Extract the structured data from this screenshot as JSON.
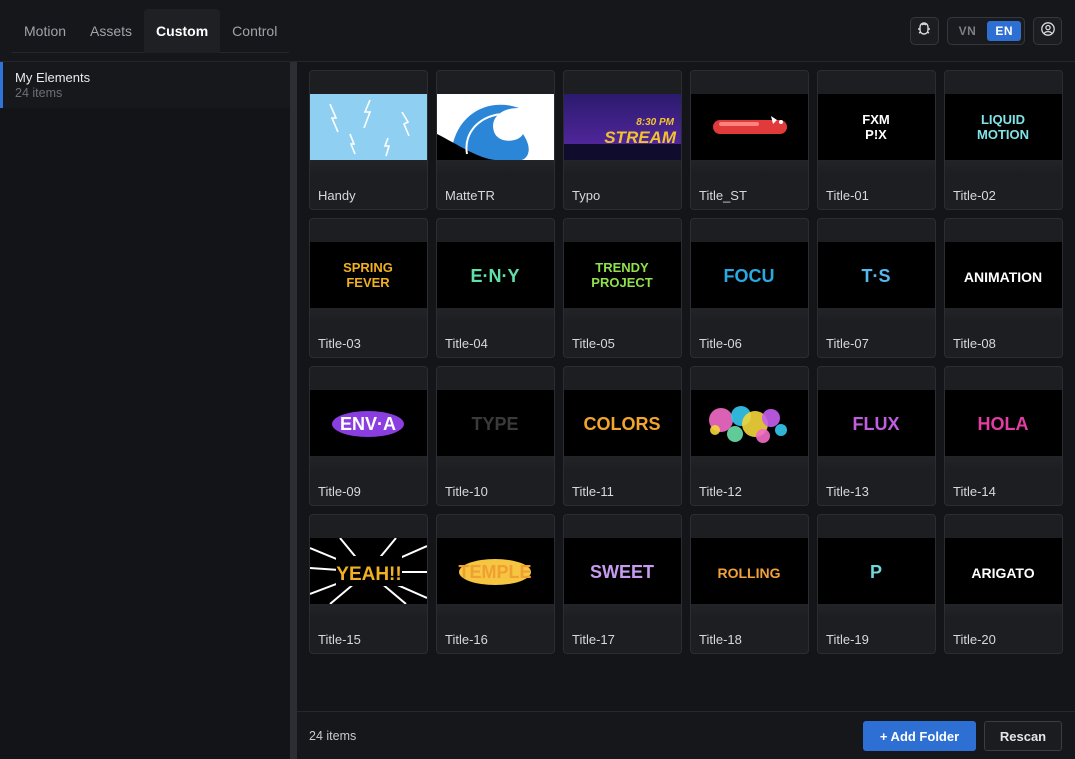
{
  "tabs": [
    {
      "label": "Motion"
    },
    {
      "label": "Assets"
    },
    {
      "label": "Custom",
      "active": true
    },
    {
      "label": "Control"
    }
  ],
  "header": {
    "icons": [
      "extension-icon",
      "user-circle-icon"
    ],
    "languages": [
      "VN",
      "EN"
    ],
    "active_language": "EN"
  },
  "sidebar": {
    "folders": [
      {
        "name": "My Elements",
        "count": "24 items",
        "selected": true
      }
    ]
  },
  "grid": {
    "items": [
      {
        "label": "Handy",
        "thumb": "lightning-sky"
      },
      {
        "label": "MatteTR",
        "thumb": "wave-matte"
      },
      {
        "label": "Typo",
        "thumb": "stream",
        "text": "STREAM",
        "sub": "8:30 PM"
      },
      {
        "label": "Title_ST",
        "thumb": "red-bar"
      },
      {
        "label": "Title-01",
        "thumb": "text",
        "text": "FXM P!X",
        "color": "#ffffff"
      },
      {
        "label": "Title-02",
        "thumb": "text",
        "text": "LIQUID MOTION",
        "color": "#7fe3e8"
      },
      {
        "label": "Title-03",
        "thumb": "text",
        "text": "SPRING FEVER",
        "color": "#f0b020"
      },
      {
        "label": "Title-04",
        "thumb": "text",
        "text": "E·N·Y",
        "color": "#5ee0a8"
      },
      {
        "label": "Title-05",
        "thumb": "text",
        "text": "TRENDY PROJECT",
        "color": "#8fe24b"
      },
      {
        "label": "Title-06",
        "thumb": "text",
        "text": "FOCU",
        "color": "#2aa8e0"
      },
      {
        "label": "Title-07",
        "thumb": "text",
        "text": "T·S",
        "color": "#56b8f0"
      },
      {
        "label": "Title-08",
        "thumb": "text",
        "text": "ANIMATION",
        "color": "#ffffff"
      },
      {
        "label": "Title-09",
        "thumb": "text",
        "text": "ENV·A",
        "color": "#ffffff",
        "badge": "#8a3ee0"
      },
      {
        "label": "Title-10",
        "thumb": "text",
        "text": "TYPE",
        "color": "#3a3a3a"
      },
      {
        "label": "Title-11",
        "thumb": "text",
        "text": "COLORS",
        "color": "#f2a52a"
      },
      {
        "label": "Title-12",
        "thumb": "confetti"
      },
      {
        "label": "Title-13",
        "thumb": "text",
        "text": "FLUX",
        "color": "#c05ee0"
      },
      {
        "label": "Title-14",
        "thumb": "text",
        "text": "HOLA",
        "color": "#e23da0"
      },
      {
        "label": "Title-15",
        "thumb": "burst",
        "text": "YEAH!!",
        "color": "#f0b020"
      },
      {
        "label": "Title-16",
        "thumb": "text",
        "text": "TEMPLE",
        "color": "#f0a030",
        "badge": "#f6c542"
      },
      {
        "label": "Title-17",
        "thumb": "text",
        "text": "SWEET",
        "color": "#c79cf0"
      },
      {
        "label": "Title-18",
        "thumb": "text",
        "text": "ROLLING",
        "color": "#f1a23a"
      },
      {
        "label": "Title-19",
        "thumb": "text",
        "text": "P",
        "color": "#6fd8d8"
      },
      {
        "label": "Title-20",
        "thumb": "text",
        "text": "ARIGATO",
        "color": "#ffffff"
      }
    ]
  },
  "footer": {
    "count": "24 items",
    "add_folder_label": "+ Add Folder",
    "rescan_label": "Rescan"
  },
  "colors": {
    "accent": "#2e6fd4",
    "background": "#141518",
    "card": "#1d1e22"
  }
}
